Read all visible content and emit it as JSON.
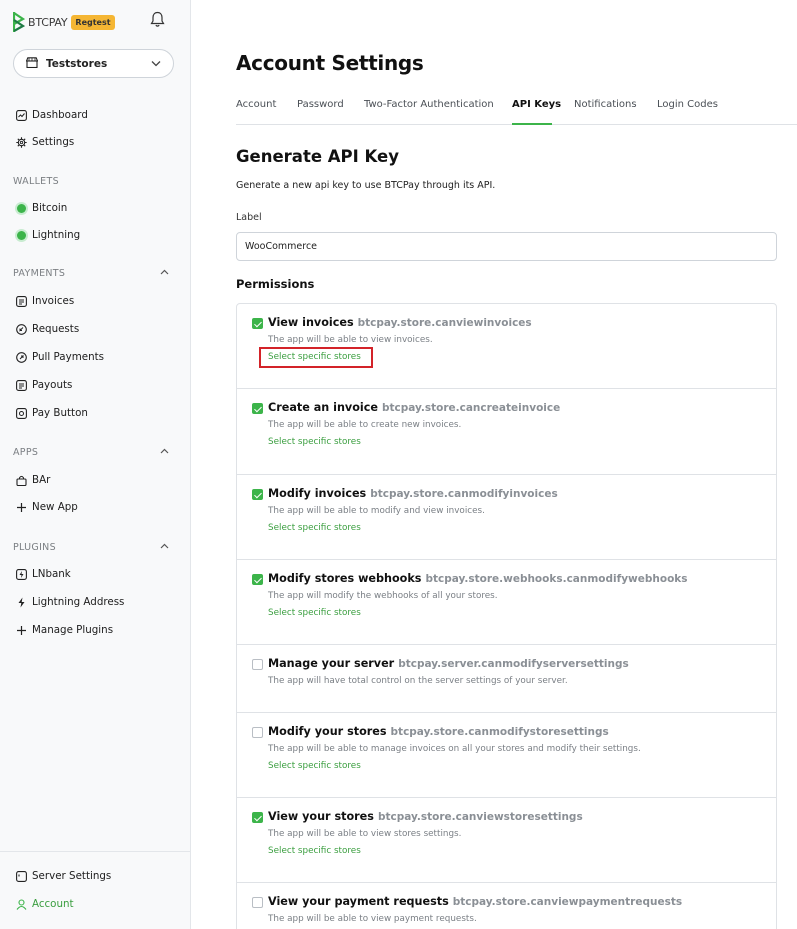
{
  "sidebar": {
    "logo_text": "BTCPAY",
    "badge": "Regtest",
    "store_name": "Teststores",
    "top_items": [
      {
        "label": "Dashboard",
        "icon": "dashboard-icon"
      },
      {
        "label": "Settings",
        "icon": "gear-icon"
      }
    ],
    "wallets_heading": "WALLETS",
    "wallets": [
      {
        "label": "Bitcoin",
        "icon": "status-dot-icon"
      },
      {
        "label": "Lightning",
        "icon": "status-dot-icon"
      }
    ],
    "payments_heading": "PAYMENTS",
    "payments": [
      {
        "label": "Invoices",
        "icon": "invoice-icon"
      },
      {
        "label": "Requests",
        "icon": "request-icon"
      },
      {
        "label": "Pull Payments",
        "icon": "pull-payment-icon"
      },
      {
        "label": "Payouts",
        "icon": "payout-icon"
      },
      {
        "label": "Pay Button",
        "icon": "pay-button-icon"
      }
    ],
    "apps_heading": "APPS",
    "apps": [
      {
        "label": "BAr",
        "icon": "shopping-bag-icon"
      },
      {
        "label": "New App",
        "icon": "plus-icon"
      }
    ],
    "plugins_heading": "PLUGINS",
    "plugins": [
      {
        "label": "LNbank",
        "icon": "lnbank-icon"
      },
      {
        "label": "Lightning Address",
        "icon": "lightning-icon"
      },
      {
        "label": "Manage Plugins",
        "icon": "plus-icon"
      }
    ],
    "bottom_items": [
      {
        "label": "Server Settings",
        "icon": "server-icon"
      },
      {
        "label": "Account",
        "icon": "user-icon"
      }
    ]
  },
  "main": {
    "title": "Account Settings",
    "tabs": [
      {
        "label": "Account"
      },
      {
        "label": "Password"
      },
      {
        "label": "Two-Factor Authentication"
      },
      {
        "label": "API Keys"
      },
      {
        "label": "Notifications"
      },
      {
        "label": "Login Codes"
      }
    ],
    "active_tab": "API Keys",
    "section_title": "Generate API Key",
    "section_desc": "Generate a new api key to use BTCPay through its API.",
    "label_field": {
      "label": "Label",
      "value": "WooCommerce"
    },
    "permissions_title": "Permissions",
    "permissions": [
      {
        "name": "View invoices",
        "code": "btcpay.store.canviewinvoices",
        "desc": "The app will be able to view invoices.",
        "checked": true,
        "link": "Select specific stores"
      },
      {
        "name": "Create an invoice",
        "code": "btcpay.store.cancreateinvoice",
        "desc": "The app will be able to create new invoices.",
        "checked": true,
        "link": "Select specific stores"
      },
      {
        "name": "Modify invoices",
        "code": "btcpay.store.canmodifyinvoices",
        "desc": "The app will be able to modify and view invoices.",
        "checked": true,
        "link": "Select specific stores"
      },
      {
        "name": "Modify stores webhooks",
        "code": "btcpay.store.webhooks.canmodifywebhooks",
        "desc": "The app will modify the webhooks of all your stores.",
        "checked": true,
        "link": "Select specific stores"
      },
      {
        "name": "Manage your server",
        "code": "btcpay.server.canmodifyserversettings",
        "desc": "The app will have total control on the server settings of your server.",
        "checked": false,
        "link": ""
      },
      {
        "name": "Modify your stores",
        "code": "btcpay.store.canmodifystoresettings",
        "desc": "The app will be able to manage invoices on all your stores and modify their settings.",
        "checked": false,
        "link": "Select specific stores"
      },
      {
        "name": "View your stores",
        "code": "btcpay.store.canviewstoresettings",
        "desc": "The app will be able to view stores settings.",
        "checked": true,
        "link": "Select specific stores"
      },
      {
        "name": "View your payment requests",
        "code": "btcpay.store.canviewpaymentrequests",
        "desc": "The app will be able to view payment requests.",
        "checked": false,
        "link": ""
      }
    ]
  },
  "colors": {
    "accent": "#3cb44a",
    "link": "#3a9e3f",
    "badge": "#f5b633",
    "highlight": "#d32329"
  }
}
